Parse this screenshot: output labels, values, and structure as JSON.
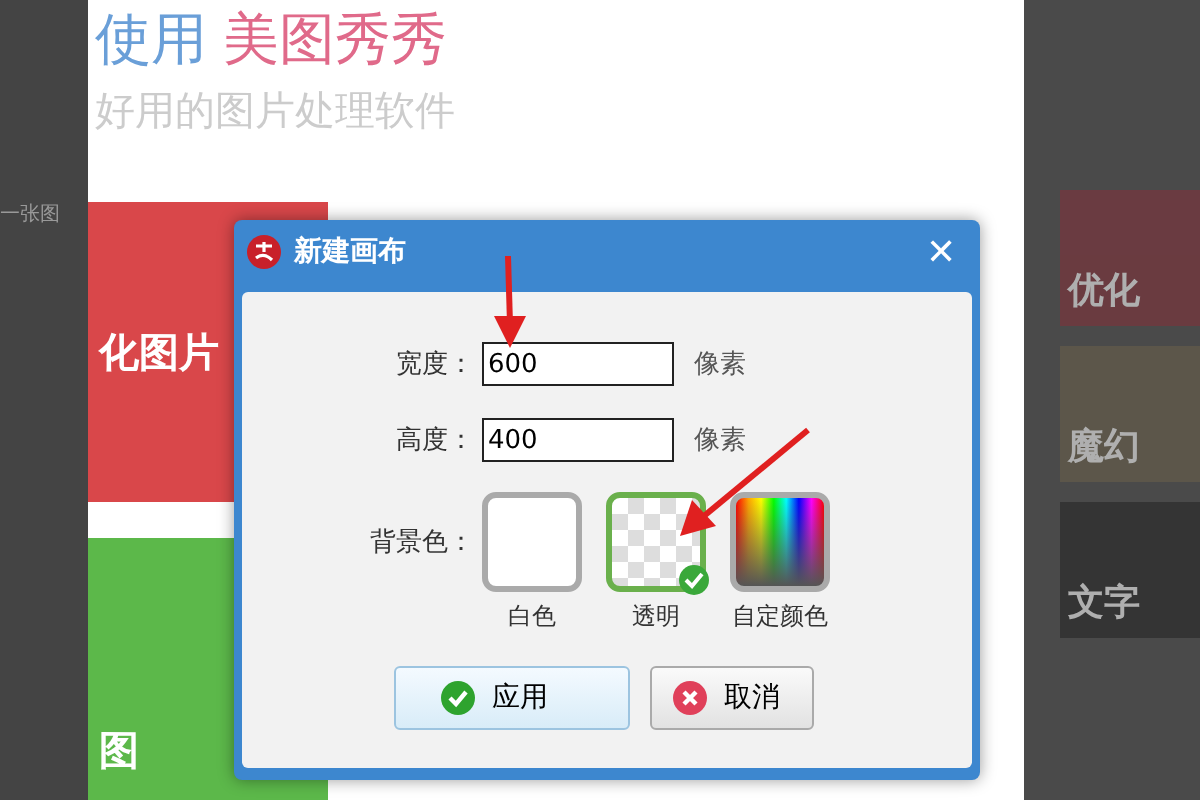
{
  "left_strip": {
    "caption": "一张图"
  },
  "page": {
    "headline": {
      "lead": "使用",
      "brand": "美图秀秀"
    },
    "subtitle": "好用的图片处理软件",
    "tiles": [
      {
        "label": "化图片",
        "color": "#d9474a"
      },
      {
        "label": "图",
        "color": "#5cb84a"
      }
    ]
  },
  "right_strip": {
    "tiles": [
      {
        "label": "优化",
        "color": "#6e3a40"
      },
      {
        "label": "魔幻",
        "color": "#5e584a"
      },
      {
        "label": "文字",
        "color": "#323232"
      }
    ]
  },
  "dialog": {
    "title": "新建画布",
    "close": "✕",
    "fields": [
      {
        "label": "宽度：",
        "value": "600",
        "unit": "像素"
      },
      {
        "label": "高度：",
        "value": "400",
        "unit": "像素"
      }
    ],
    "background_label": "背景色：",
    "swatches": [
      {
        "kind": "white",
        "label": "白色",
        "selected": false
      },
      {
        "kind": "transparent",
        "label": "透明",
        "selected": true
      },
      {
        "kind": "spectrum",
        "label": "自定颜色",
        "selected": false
      }
    ],
    "buttons": [
      {
        "kind": "apply",
        "label": "应用"
      },
      {
        "kind": "cancel",
        "label": "取消"
      }
    ]
  }
}
